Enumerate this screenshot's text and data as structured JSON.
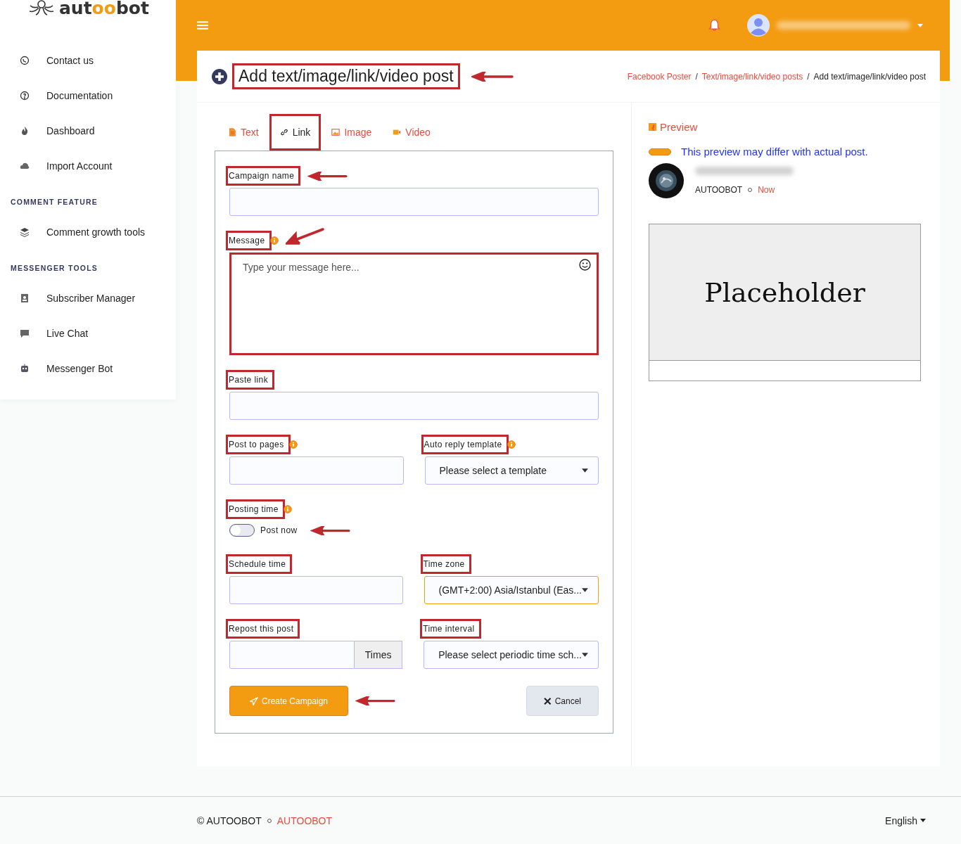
{
  "logo": {
    "start": "aut",
    "accent": "oo",
    "end": "bot"
  },
  "sidebar": [
    {
      "kind": "item",
      "label": "Contact us"
    },
    {
      "kind": "item",
      "label": "Documentation"
    },
    {
      "kind": "item",
      "label": "Dashboard"
    },
    {
      "kind": "item",
      "label": "Import Account"
    },
    {
      "kind": "section",
      "label": "COMMENT FEATURE"
    },
    {
      "kind": "item",
      "label": "Comment growth tools"
    },
    {
      "kind": "section",
      "label": "MESSENGER TOOLS"
    },
    {
      "kind": "item",
      "label": "Subscriber Manager"
    },
    {
      "kind": "item",
      "label": "Live Chat"
    },
    {
      "kind": "item",
      "label": "Messenger Bot"
    }
  ],
  "page_title": {
    "text": "Add text/image/link/video post",
    "highlighted": true,
    "arrow": true
  },
  "breadcrumbs": [
    {
      "kind": "link",
      "label": "Facebook Poster"
    },
    {
      "kind": "separator",
      "label": "/"
    },
    {
      "kind": "link",
      "label": "Text/image/link/video posts"
    },
    {
      "kind": "separator",
      "label": "/"
    },
    {
      "kind": "current",
      "label": "Add text/image/link/video post"
    }
  ],
  "tabs": [
    {
      "label": "Text",
      "selected": false,
      "highlighted": false
    },
    {
      "label": "Link",
      "selected": true,
      "highlighted": true
    },
    {
      "label": "Image",
      "selected": false,
      "highlighted": false
    },
    {
      "label": "Video",
      "selected": false,
      "highlighted": false
    }
  ],
  "form_rows": [
    [
      {
        "kind": "text",
        "label": "Campaign name",
        "info": false,
        "highlighted": true,
        "arrow": true
      }
    ],
    [
      {
        "kind": "textarea",
        "label": "Message",
        "info": true,
        "highlighted": true,
        "arrow": true,
        "placeholder": "Type your message here...",
        "field_highlighted": true
      }
    ],
    [
      {
        "kind": "text",
        "label": "Paste link",
        "info": false,
        "highlighted": true,
        "arrow": false
      }
    ],
    [
      {
        "kind": "text",
        "label": "Post to pages",
        "info": true,
        "highlighted": true,
        "arrow": false
      },
      {
        "kind": "select",
        "label": "Auto reply template",
        "info": true,
        "highlighted": true,
        "arrow": false,
        "value": "Please select a template",
        "focused": false
      }
    ],
    [
      {
        "kind": "toggle",
        "label": "Posting time",
        "info": true,
        "highlighted": true,
        "arrow": false,
        "toggle_label": "Post now",
        "on": false,
        "toggle_arrow": true
      }
    ],
    [
      {
        "kind": "text",
        "label": "Schedule time",
        "info": false,
        "highlighted": true,
        "arrow": false
      },
      {
        "kind": "select",
        "label": "Time zone",
        "info": false,
        "highlighted": true,
        "arrow": false,
        "value": "(GMT+2:00) Asia/Istanbul (Eas...",
        "focused": true
      }
    ],
    [
      {
        "kind": "addon",
        "label": "Repost this post",
        "info": false,
        "highlighted": true,
        "arrow": false,
        "addon": "Times"
      },
      {
        "kind": "select",
        "label": "Time interval",
        "info": false,
        "highlighted": true,
        "arrow": false,
        "value": "Please select periodic time sch...",
        "focused": false
      }
    ]
  ],
  "buttons": [
    {
      "kind": "primary",
      "label": "Create Campaign",
      "arrow": true
    },
    {
      "kind": "secondary",
      "label": "Cancel",
      "arrow": false
    }
  ],
  "preview": {
    "title": "Preview",
    "note": "This preview may differ with actual post.",
    "page": "AUTOOBOT",
    "time": "Now",
    "placeholder": "Placeholder"
  },
  "footer": {
    "copyright": "© AUTOOBOT",
    "link": "AUTOOBOT",
    "language": "English"
  }
}
